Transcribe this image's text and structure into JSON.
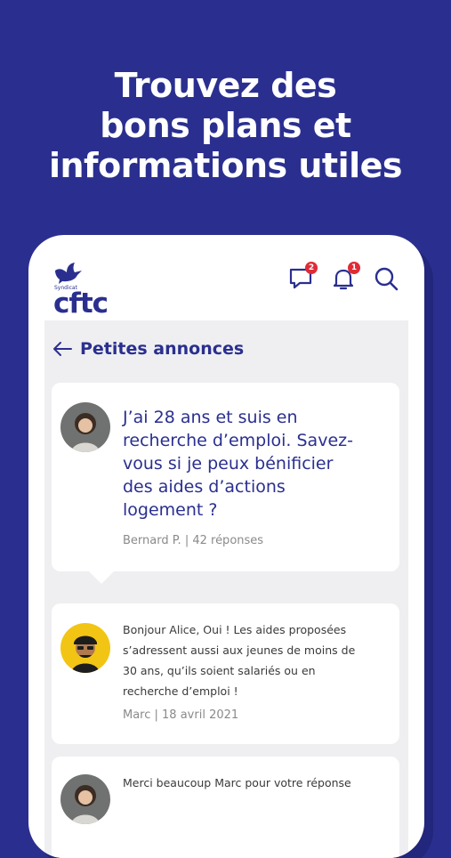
{
  "hero": {
    "line1": "Trouvez des",
    "line2": "bons plans et",
    "line3": "informations utiles"
  },
  "app": {
    "logo_small": "Syndicat",
    "logo_word": "cftc",
    "messages_badge": "2",
    "notifications_badge": "1"
  },
  "page": {
    "title": "Petites annonces"
  },
  "question": {
    "lines": [
      "J’ai 28 ans et suis en",
      "recherche d’emploi. Savez-",
      "vous si je peux bénificier",
      "des aides d’actions",
      "logement ?"
    ],
    "meta": "Bernard P. | 42 réponses"
  },
  "replies": [
    {
      "lines": [
        "Bonjour Alice, Oui ! Les aides proposées",
        "s’adressent aussi aux jeunes de moins de",
        "30 ans, qu’ils soient salariés ou en",
        "recherche d’emploi !"
      ],
      "meta": "Marc | 18 avril 2021"
    },
    {
      "lines": [
        "Merci beaucoup Marc pour votre réponse"
      ]
    }
  ],
  "colors": {
    "brand": "#2a2f8f",
    "badge": "#e02b36",
    "screen_bg": "#efeff1"
  },
  "icons": [
    "dove-logo-icon",
    "chat-icon",
    "bell-icon",
    "search-icon",
    "arrow-left-icon"
  ]
}
